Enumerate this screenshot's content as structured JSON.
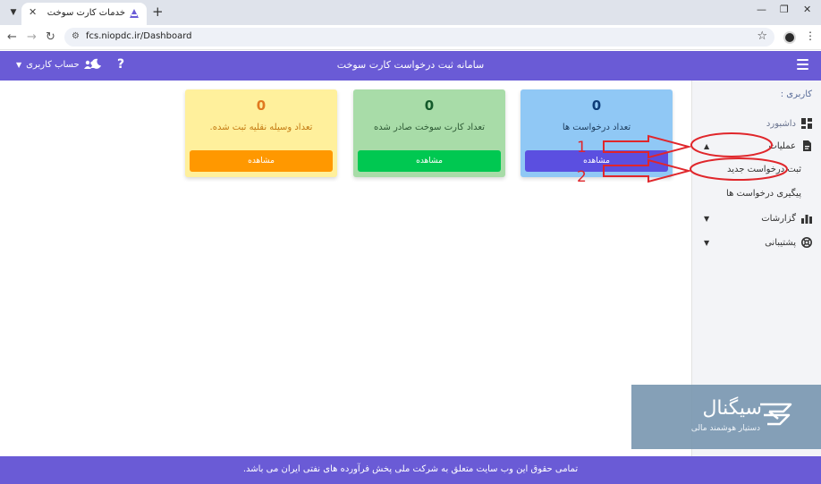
{
  "browser": {
    "tab_title": "خدمات کارت سوخت",
    "url": "fcs.niopdc.ir/Dashboard"
  },
  "header": {
    "title": "سامانه ثبت درخواست کارت سوخت",
    "account_label": "حساب کاربری",
    "help_label": "?"
  },
  "sidebar": {
    "heading": "کاربری :",
    "items": [
      {
        "label": "داشبورد",
        "icon": "dashboard-icon"
      },
      {
        "label": "عملیات",
        "icon": "document-icon",
        "expanded": true
      },
      {
        "label": "ثبت درخواست جدید",
        "sub": true
      },
      {
        "label": "پیگیری درخواست ها",
        "sub": true
      },
      {
        "label": "گزارشات",
        "icon": "bar-chart-icon"
      },
      {
        "label": "پشتیبانی",
        "icon": "support-icon"
      }
    ]
  },
  "cards": [
    {
      "value": "0",
      "label": "تعداد درخواست ها",
      "button": "مشاهده"
    },
    {
      "value": "0",
      "label": "تعداد کارت سوخت صادر شده",
      "button": "مشاهده"
    },
    {
      "value": "0",
      "label": "تعداد وسیله نقلیه ثبت شده.",
      "button": "مشاهده"
    }
  ],
  "annotations": {
    "step1": "1",
    "step2": "2"
  },
  "watermark": {
    "name": "سیگنال",
    "tagline": "دستیار هوشمند مالی"
  },
  "footer": {
    "text": "تمامی حقوق این وب سایت متعلق به شرکت ملی پخش فرآورده های نفتی ایران می باشد."
  },
  "colors": {
    "primary": "#6a5bd6",
    "card_blue": "#90c8f5",
    "card_green": "#a8dca8",
    "card_yellow": "#fff09c",
    "btn_blue": "#5b4fe0",
    "btn_green": "#00c851",
    "btn_orange": "#ff9800",
    "annotation_red": "#e0262b"
  }
}
